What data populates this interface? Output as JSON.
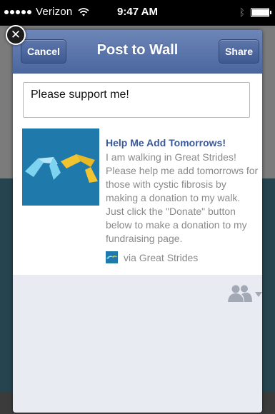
{
  "status_bar": {
    "carrier": "Verizon",
    "time": "9:47 AM",
    "bluetooth_icon": "bluetooth-icon",
    "battery_level": 0.95
  },
  "dialog": {
    "close_icon": "close-icon",
    "cancel_label": "Cancel",
    "title": "Post to Wall",
    "share_label": "Share",
    "message": "Please support me!",
    "link": {
      "title": "Help Me Add Tomorrows!",
      "description": "I am walking in Great Strides! Please help me add tomorrows for those with cystic fibrosis by making a donation to my walk. Just click the \"Donate\" button below to make a donation to my fundraising page.",
      "via": "via Great Strides"
    },
    "audience_icon": "people-icon"
  },
  "colors": {
    "nav_blue": "#4b679f",
    "link_blue": "#3b5998",
    "thumbnail_blue": "#1f79aa",
    "logo_yellow": "#f2c530",
    "logo_cyan": "#7dd3f0"
  }
}
